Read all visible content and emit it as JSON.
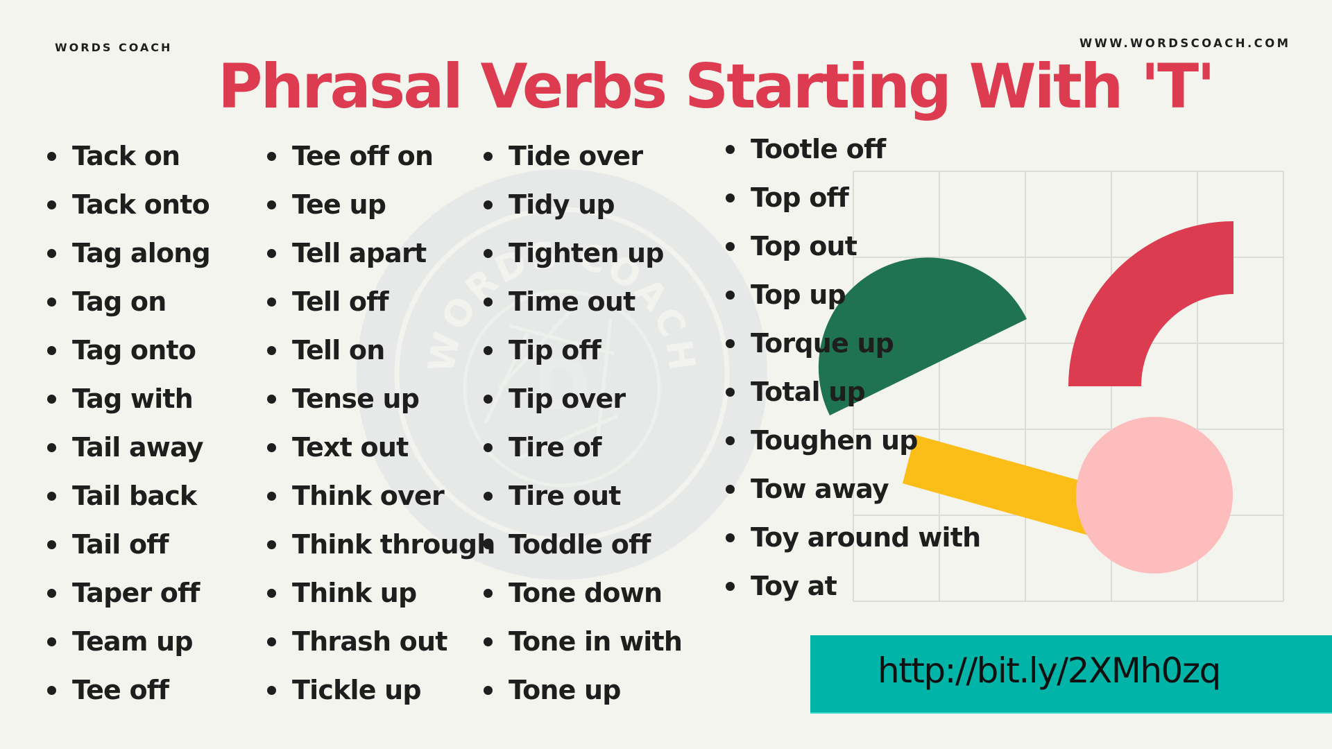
{
  "header": {
    "brand_left": "WORDS COACH",
    "brand_right": "WWW.WORDSCOACH.COM",
    "title": "Phrasal Verbs Starting With 'T'"
  },
  "watermark": {
    "text": "WORDS COACH",
    "letter": "D"
  },
  "columns": [
    [
      "Tack on",
      "Tack onto",
      "Tag along",
      "Tag on",
      "Tag onto",
      "Tag with",
      "Tail away",
      "Tail back",
      "Tail off",
      "Taper off",
      "Team up",
      "Tee off"
    ],
    [
      "Tee off on",
      "Tee up",
      "Tell apart",
      "Tell off",
      "Tell on",
      "Tense up",
      "Text out",
      "Think over",
      "Think through",
      "Think up",
      "Thrash out",
      "Tickle up"
    ],
    [
      "Tide over",
      "Tidy up",
      "Tighten up",
      "Time out",
      "Tip off",
      "Tip over",
      "Tire of",
      "Tire out",
      "Toddle off",
      "Tone down",
      "Tone in with",
      "Tone up"
    ],
    [
      "Tootle off",
      "Top off",
      "Top out",
      "Top up",
      "Torque up",
      "Total up",
      "Toughen up",
      "Tow away",
      "Toy around with",
      "Toy at"
    ]
  ],
  "link": {
    "url_text": "http://bit.ly/2XMh0zq"
  },
  "colors": {
    "background": "#f4f4ef",
    "title_red": "#dc3b50",
    "text_dark": "#1e1e1e",
    "watermark": "#e6e9e8",
    "grid_line": "#dcdcd6",
    "green_shape": "#1f7352",
    "red_shape": "#dc3c50",
    "yellow_shape": "#fbbd17",
    "pink_shape": "#fdbdbd",
    "banner_teal": "#00b4a8"
  }
}
